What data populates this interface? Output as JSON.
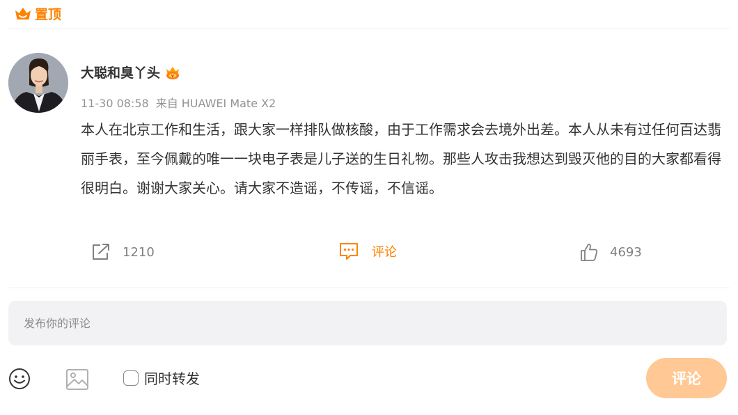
{
  "pinned": {
    "label": "置顶",
    "icon": "crown-icon",
    "color": "#ff8200"
  },
  "post": {
    "author": {
      "name": "大聪和臭丫头",
      "badge_icon": "vip-badge-icon"
    },
    "time": "11-30 08:58",
    "source": "来自 HUAWEI Mate X2",
    "text": "本人在北京工作和生活，跟大家一样排队做核酸，由于工作需求会去境外出差。本人从未有过任何百达翡丽手表，至今佩戴的唯一一块电子表是儿子送的生日礼物。那些人攻击我想达到毁灭他的目的大家都看得很明白。谢谢大家关心。请大家不造谣，不传谣，不信谣。"
  },
  "actions": {
    "repost_count": "1210",
    "comment_label": "评论",
    "like_count": "4693",
    "accent_color": "#ff8200"
  },
  "composer": {
    "placeholder": "发布你的评论",
    "repost_label": "同时转发",
    "submit_label": "评论",
    "submit_color": "#ffc894"
  }
}
